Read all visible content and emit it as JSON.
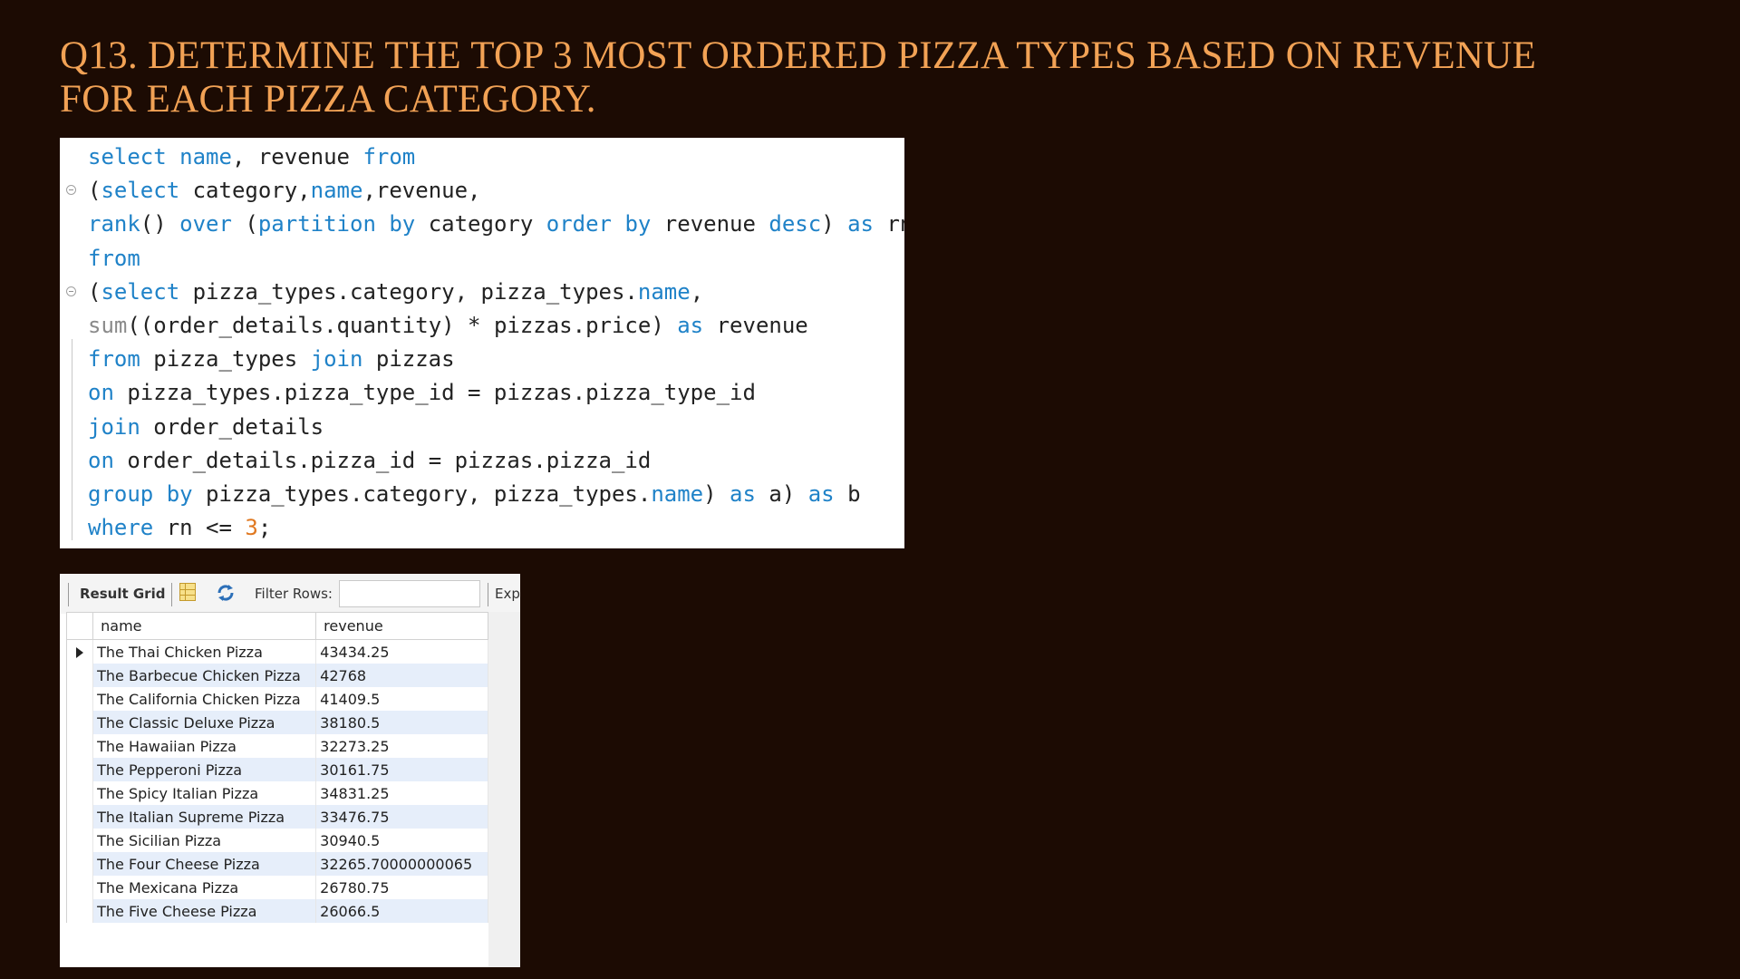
{
  "title": {
    "line1": "Q13. DETERMINE THE TOP 3 MOST ORDERED PIZZA TYPES BASED ON REVENUE",
    "line2": "FOR EACH PIZZA CATEGORY."
  },
  "colors": {
    "background": "#1c0b03",
    "title": "#f2a255",
    "keyword": "#1f82c8",
    "function": "#8a8a8a",
    "number": "#e07820",
    "row_stripe": "#e6eefa"
  },
  "sql": {
    "lines": [
      [
        {
          "t": "select name",
          "c": "kw"
        },
        {
          "t": ", revenue ",
          "c": ""
        },
        {
          "t": "from",
          "c": "kw"
        }
      ],
      [
        {
          "t": "(",
          "c": ""
        },
        {
          "t": "select",
          "c": "kw"
        },
        {
          "t": " category,",
          "c": ""
        },
        {
          "t": "name",
          "c": "kw"
        },
        {
          "t": ",revenue,",
          "c": ""
        }
      ],
      [
        {
          "t": "rank",
          "c": "kw"
        },
        {
          "t": "() ",
          "c": ""
        },
        {
          "t": "over",
          "c": "kw"
        },
        {
          "t": " (",
          "c": ""
        },
        {
          "t": "partition by",
          "c": "kw"
        },
        {
          "t": " category ",
          "c": ""
        },
        {
          "t": "order by",
          "c": "kw"
        },
        {
          "t": " revenue ",
          "c": ""
        },
        {
          "t": "desc",
          "c": "kw"
        },
        {
          "t": ") ",
          "c": ""
        },
        {
          "t": "as",
          "c": "kw"
        },
        {
          "t": " rn",
          "c": ""
        }
      ],
      [
        {
          "t": "from",
          "c": "kw"
        }
      ],
      [
        {
          "t": "(",
          "c": ""
        },
        {
          "t": "select",
          "c": "kw"
        },
        {
          "t": " pizza_types.category, pizza_types.",
          "c": ""
        },
        {
          "t": "name",
          "c": "kw"
        },
        {
          "t": ",",
          "c": ""
        }
      ],
      [
        {
          "t": "sum",
          "c": "fn"
        },
        {
          "t": "((order_details.quantity) * pizzas.price) ",
          "c": ""
        },
        {
          "t": "as",
          "c": "kw"
        },
        {
          "t": " revenue",
          "c": ""
        }
      ],
      [
        {
          "t": "from",
          "c": "kw"
        },
        {
          "t": " pizza_types ",
          "c": ""
        },
        {
          "t": "join",
          "c": "kw"
        },
        {
          "t": " pizzas",
          "c": ""
        }
      ],
      [
        {
          "t": "on",
          "c": "kw"
        },
        {
          "t": " pizza_types.pizza_type_id = pizzas.pizza_type_id",
          "c": ""
        }
      ],
      [
        {
          "t": "join",
          "c": "kw"
        },
        {
          "t": " order_details",
          "c": ""
        }
      ],
      [
        {
          "t": "on",
          "c": "kw"
        },
        {
          "t": " order_details.pizza_id = pizzas.pizza_id",
          "c": ""
        }
      ],
      [
        {
          "t": "group by",
          "c": "kw"
        },
        {
          "t": " pizza_types.category, pizza_types.",
          "c": ""
        },
        {
          "t": "name",
          "c": "kw"
        },
        {
          "t": ") ",
          "c": ""
        },
        {
          "t": "as",
          "c": "kw"
        },
        {
          "t": " a) ",
          "c": ""
        },
        {
          "t": "as",
          "c": "kw"
        },
        {
          "t": " b",
          "c": ""
        }
      ],
      [
        {
          "t": "where",
          "c": "kw"
        },
        {
          "t": " rn <= ",
          "c": ""
        },
        {
          "t": "3",
          "c": "num"
        },
        {
          "t": ";",
          "c": ""
        }
      ]
    ]
  },
  "result_grid": {
    "toolbar": {
      "result_grid_label": "Result Grid",
      "filter_rows_label": "Filter Rows:",
      "filter_value": "",
      "export_label": "Exp"
    },
    "columns": [
      "name",
      "revenue"
    ],
    "rows": [
      {
        "name": "The Thai Chicken Pizza",
        "revenue": "43434.25"
      },
      {
        "name": "The Barbecue Chicken Pizza",
        "revenue": "42768"
      },
      {
        "name": "The California Chicken Pizza",
        "revenue": "41409.5"
      },
      {
        "name": "The Classic Deluxe Pizza",
        "revenue": "38180.5"
      },
      {
        "name": "The Hawaiian Pizza",
        "revenue": "32273.25"
      },
      {
        "name": "The Pepperoni Pizza",
        "revenue": "30161.75"
      },
      {
        "name": "The Spicy Italian Pizza",
        "revenue": "34831.25"
      },
      {
        "name": "The Italian Supreme Pizza",
        "revenue": "33476.75"
      },
      {
        "name": "The Sicilian Pizza",
        "revenue": "30940.5"
      },
      {
        "name": "The Four Cheese Pizza",
        "revenue": "32265.70000000065"
      },
      {
        "name": "The Mexicana Pizza",
        "revenue": "26780.75"
      },
      {
        "name": "The Five Cheese Pizza",
        "revenue": "26066.5"
      }
    ]
  }
}
